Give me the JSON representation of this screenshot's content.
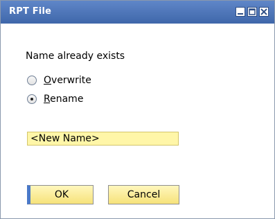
{
  "window": {
    "title": "RPT File",
    "controls": {
      "minimize": "minimize-icon",
      "maximize": "maximize-icon",
      "close": "close-icon"
    }
  },
  "dialog": {
    "message": "Name already exists",
    "options": [
      {
        "label": "Overwrite",
        "access_key": "O",
        "label_rest": "verwrite",
        "selected": false
      },
      {
        "label": "Rename",
        "access_key": "R",
        "label_rest": "ename",
        "selected": true
      }
    ],
    "name_field": {
      "value": "<New Name>"
    },
    "buttons": {
      "ok": "OK",
      "cancel": "Cancel"
    }
  }
}
